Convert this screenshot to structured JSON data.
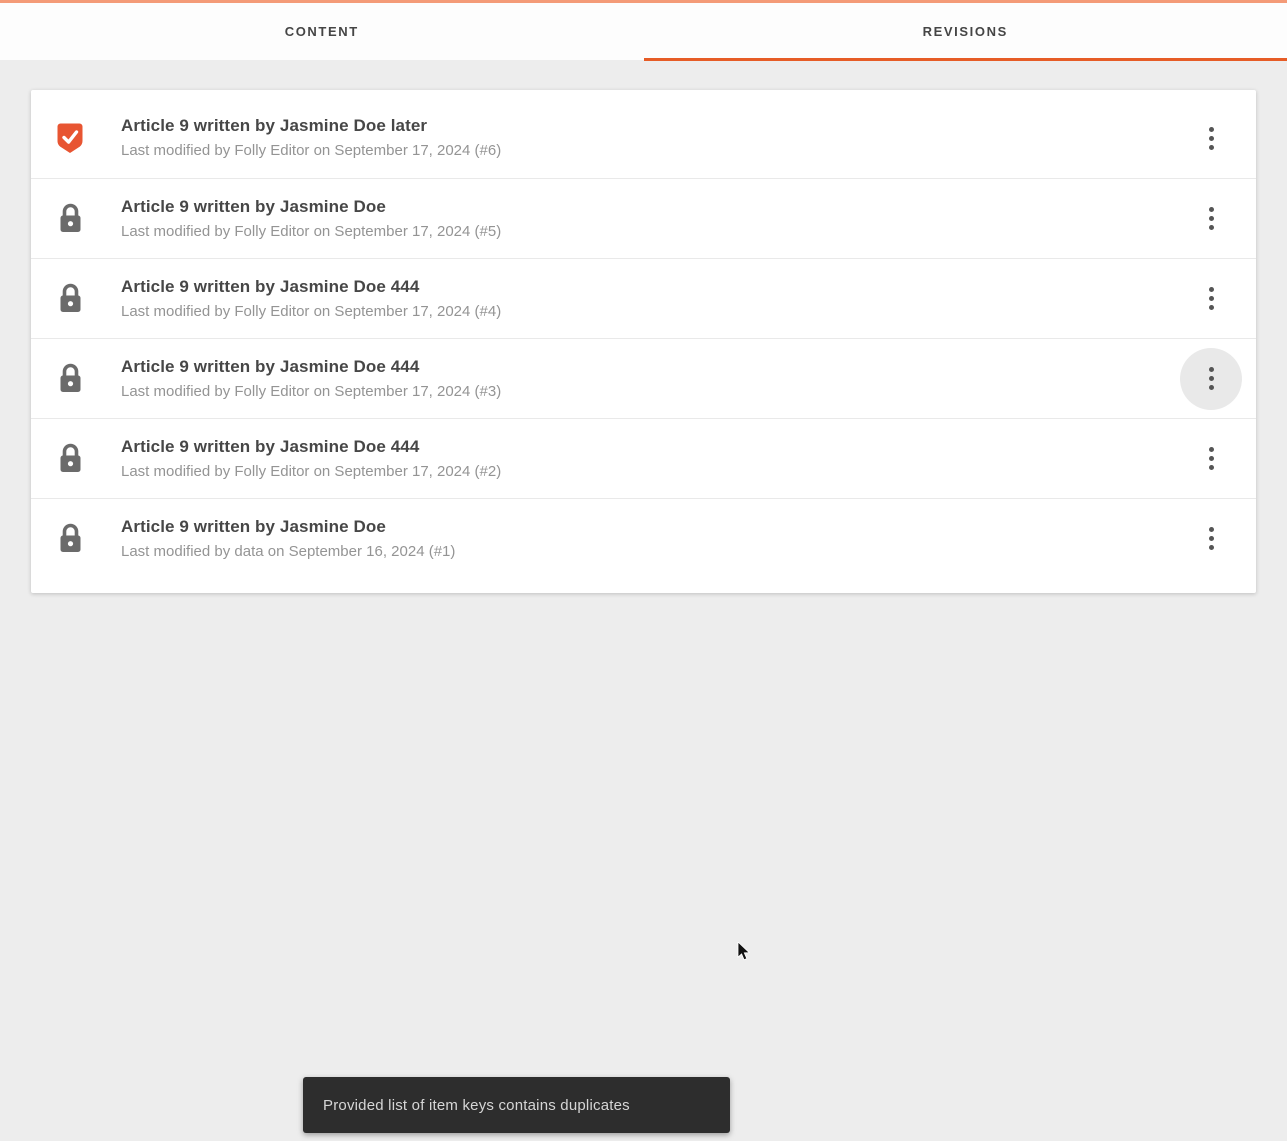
{
  "colors": {
    "accent": "#e65c26",
    "accent_soft": "#f49b78",
    "shield": "#e85532",
    "toast_bg": "#2d2d2d",
    "page_bg": "#ededed"
  },
  "tabs": [
    {
      "label": "CONTENT",
      "active": false
    },
    {
      "label": "REVISIONS",
      "active": true
    }
  ],
  "revisions": [
    {
      "icon": "verified-shield",
      "title": "Article 9 written by Jasmine Doe later",
      "meta": "Last modified by Folly Editor on September 17, 2024 (#6)",
      "menu_hovered": false
    },
    {
      "icon": "lock",
      "title": "Article 9 written by Jasmine Doe",
      "meta": "Last modified by Folly Editor on September 17, 2024 (#5)",
      "menu_hovered": false
    },
    {
      "icon": "lock",
      "title": "Article 9 written by Jasmine Doe 444",
      "meta": "Last modified by Folly Editor on September 17, 2024 (#4)",
      "menu_hovered": false
    },
    {
      "icon": "lock",
      "title": "Article 9 written by Jasmine Doe 444",
      "meta": "Last modified by Folly Editor on September 17, 2024 (#3)",
      "menu_hovered": true
    },
    {
      "icon": "lock",
      "title": "Article 9 written by Jasmine Doe 444",
      "meta": "Last modified by Folly Editor on September 17, 2024 (#2)",
      "menu_hovered": false
    },
    {
      "icon": "lock",
      "title": "Article 9 written by Jasmine Doe",
      "meta": "Last modified by data on September 16, 2024 (#1)",
      "menu_hovered": false
    }
  ],
  "toast": {
    "message": "Provided list of item keys contains duplicates"
  }
}
